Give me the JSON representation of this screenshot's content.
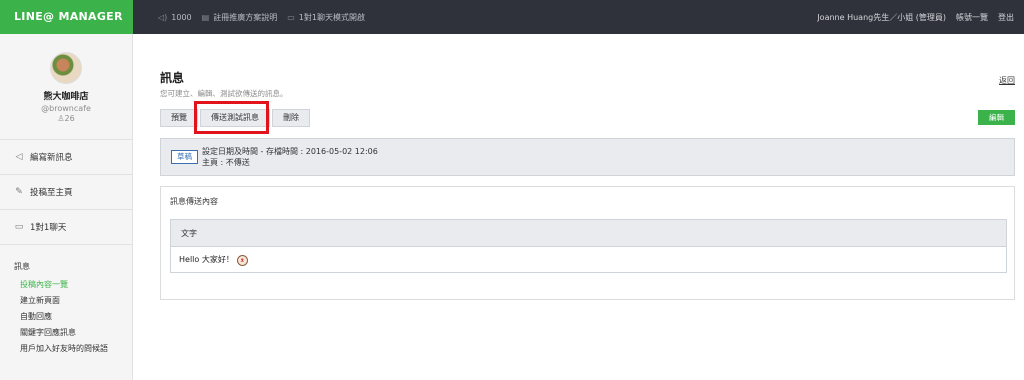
{
  "topbar": {
    "logo": "LINE@ MANAGER",
    "nav": [
      {
        "icon": "megaphone-icon",
        "label": "1000"
      },
      {
        "icon": "document-icon",
        "label": "註冊推廣方案說明"
      },
      {
        "icon": "chat-icon",
        "label": "1對1聊天模式開啟"
      }
    ],
    "user": "Joanne Huang先生／小姐 (管理員)",
    "accounts": "帳號一覽",
    "logout": "登出"
  },
  "sidebar": {
    "shop_name": "熊大咖啡店",
    "shop_id": "@browncafe",
    "friends": "26",
    "links": [
      {
        "icon": "megaphone-icon",
        "label": "編寫新訊息"
      },
      {
        "icon": "edit-icon",
        "label": "投稿至主頁"
      },
      {
        "icon": "chat-icon",
        "label": "1對1聊天"
      }
    ],
    "section": {
      "head": "訊息",
      "items": [
        "投稿內容一覽",
        "建立新頁面",
        "自動回應",
        "關鍵字回應訊息",
        "用戶加入好友時的問候語"
      ]
    }
  },
  "main": {
    "title": "訊息",
    "subtitle": "您可建立、編輯、測試欲傳送的訊息。",
    "back": "返回",
    "tabs": [
      "預覽",
      "傳送測試訊息",
      "刪除"
    ],
    "edit": "編輯",
    "status": {
      "badge": "草稿",
      "line1": "設定日期及時間 -    存檔時間 : 2016-05-02 12:06",
      "line2": "主頁 : 不傳送"
    },
    "content": {
      "heading": "訊息傳送內容",
      "table_head": "文字",
      "message": "Hello 大家好！"
    }
  },
  "colors": {
    "brand_green": "#3cb34a",
    "topbar": "#2f323a",
    "highlight": "#e0141a"
  }
}
